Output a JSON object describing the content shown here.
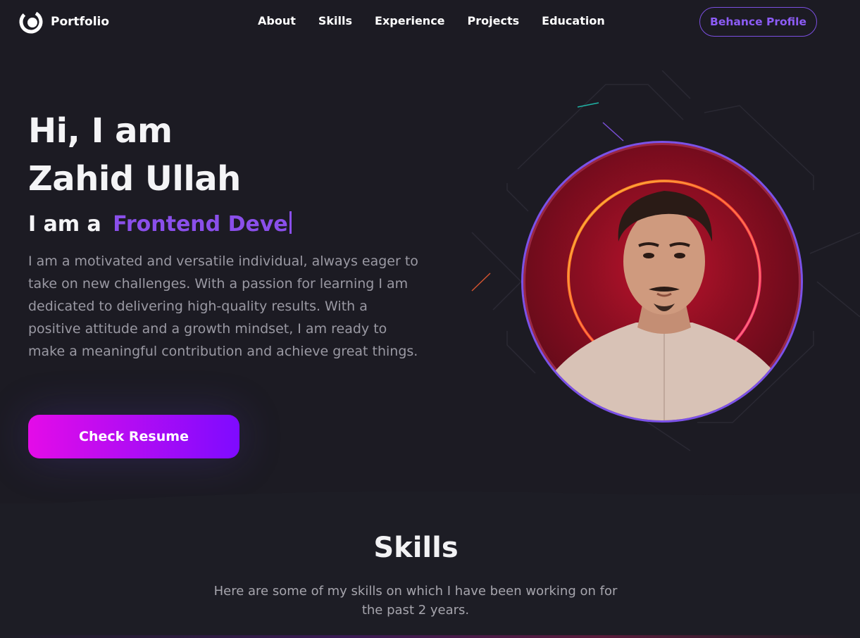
{
  "nav": {
    "logo_text": "Portfolio",
    "links": [
      "About",
      "Skills",
      "Experience",
      "Projects",
      "Education"
    ],
    "behance_label": "Behance Profile"
  },
  "hero": {
    "title_line1": "Hi, I am",
    "title_line2": "Zahid Ullah",
    "role_prefix": "I am a",
    "role_typed": "Frontend Deve",
    "intro": "I am a motivated and versatile individual, always eager to take on new challenges. With a passion for learning I am dedicated to delivering high-quality results. With a positive attitude and a growth mindset, I am ready to make a meaningful contribution and achieve great things.",
    "resume_label": "Check Resume"
  },
  "skills": {
    "title": "Skills",
    "description": "Here are some of my skills on which I have been working on for the past 2 years."
  },
  "colors": {
    "background": "#1c1b23",
    "accent": "#8a4fea",
    "resume_gradient_start": "#e40ce8",
    "resume_gradient_end": "#7e0bff"
  },
  "icons": {
    "logo": "portfolio-logo-icon"
  }
}
